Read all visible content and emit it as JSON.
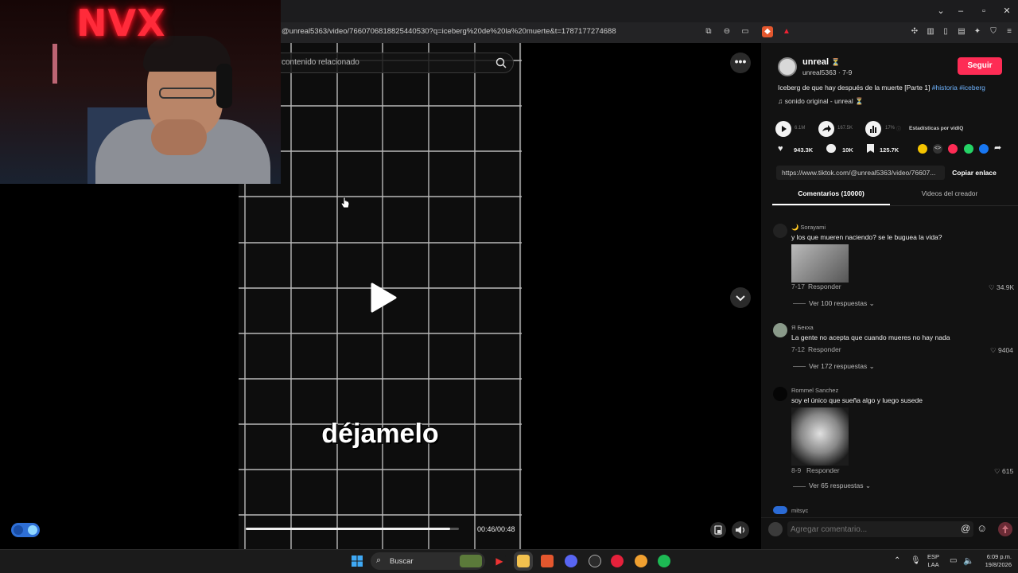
{
  "browser": {
    "url": "@unreal5363/video/7660706818825440530?q=iceberg%20de%20la%20muerte&t=1787177274688",
    "window_controls": [
      "chevron-down",
      "minimize",
      "restore",
      "close"
    ]
  },
  "webcam": {
    "neon_sign": "NVX"
  },
  "video": {
    "search_placeholder": "contenido relacionado",
    "caption": "déjamelo",
    "time": "00:46/00:48",
    "progress": 0.96
  },
  "creator": {
    "name": "unreal",
    "name_emoji": "⏳",
    "handle": "unreal5363 · 7-9",
    "follow_label": "Seguir",
    "description": "Iceberg de que hay después de la muerte [Parte 1]",
    "hashtags": [
      "#historia",
      "#iceberg"
    ],
    "sound": "sonido original - unreal ⏳"
  },
  "stats": {
    "plays": "6.1M",
    "shares": "167.5K",
    "ratio": "17%",
    "vidiq_label": "Estadísticas por vidIQ",
    "likes": "943.3K",
    "comments": "10K",
    "saves": "125.7K"
  },
  "share": {
    "link": "https://www.tiktok.com/@unreal5363/video/76607...",
    "copy_label": "Copiar enlace"
  },
  "tabs": {
    "comments": "Comentarios (10000)",
    "videos": "Videos del creador"
  },
  "comments": [
    {
      "author": "🌙 Sorayami",
      "text": "y los que mueren naciendo? se le buguea la vida?",
      "date": "7-17",
      "reply": "Responder",
      "likes": "34.9K",
      "replies": "Ver 100 respuestas"
    },
    {
      "author": "Я Бекха",
      "text": "La gente no acepta que cuando mueres no hay nada",
      "date": "7-12",
      "reply": "Responder",
      "likes": "9404",
      "replies": "Ver 172 respuestas"
    },
    {
      "author": "Rommel Sanchez",
      "text": "soy el único que sueña algo y luego susede",
      "date": "8-9",
      "reply": "Responder",
      "likes": "615",
      "replies": "Ver 65 respuestas"
    },
    {
      "author": "mitsyc"
    }
  ],
  "comment_input": {
    "placeholder": "Agregar comentario..."
  },
  "taskbar": {
    "search_label": "Buscar",
    "lang_top": "ESP",
    "lang_bottom": "LAA",
    "time": "6:09 p.m.",
    "date": "19/8/2026"
  },
  "colors": {
    "follow": "#fe2c55",
    "hashtag": "#6fb4ff",
    "neon": "#ff2b3a"
  }
}
